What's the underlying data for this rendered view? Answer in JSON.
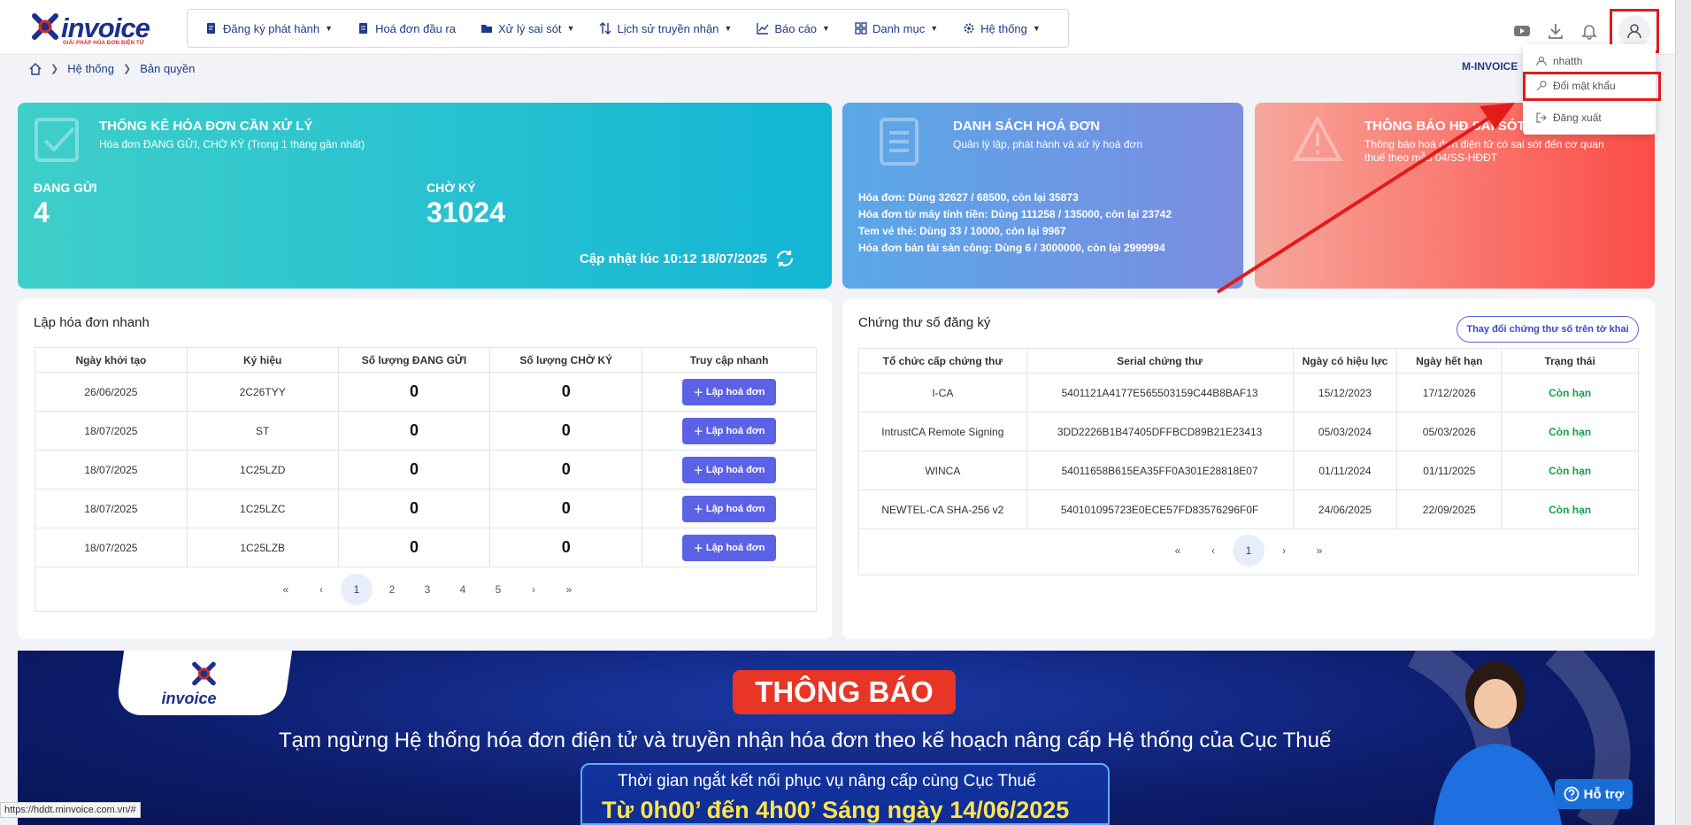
{
  "brand": {
    "name": "invoice",
    "tagline": "GIẢI PHÁP HÓA ĐƠN ĐIỆN TỬ"
  },
  "nav": [
    {
      "label": "Đăng ký phát hành",
      "icon": "file-edit-icon",
      "has_dropdown": true
    },
    {
      "label": "Hoá đơn đầu ra",
      "icon": "document-icon",
      "has_dropdown": false
    },
    {
      "label": "Xử lý sai sót",
      "icon": "folder-search-icon",
      "has_dropdown": true
    },
    {
      "label": "Lịch sử truyền nhận",
      "icon": "sort-arrows-icon",
      "has_dropdown": true
    },
    {
      "label": "Báo cáo",
      "icon": "line-chart-icon",
      "has_dropdown": true
    },
    {
      "label": "Danh mục",
      "icon": "grid-icon",
      "has_dropdown": true
    },
    {
      "label": "Hệ thống",
      "icon": "gear-icon",
      "has_dropdown": true
    }
  ],
  "breadcrumb": [
    "Hệ thống",
    "Bản quyền"
  ],
  "company_code": "M-INVOICE",
  "user_menu": {
    "username": "nhatth",
    "change_password": "Đổi mật khẩu",
    "logout": "Đăng xuất"
  },
  "stat_card": {
    "title": "THỐNG KÊ HÓA ĐƠN CẦN XỬ LÝ",
    "subtitle": "Hóa đơn ĐANG GỬI, CHỜ KÝ (Trong 1 tháng gần nhất)",
    "sending_label": "ĐANG GỬI",
    "sending_value": "4",
    "waiting_label": "CHỜ KÝ",
    "waiting_value": "31024",
    "updated": "Cập nhật lúc 10:12 18/07/2025"
  },
  "list_card": {
    "title": "DANH SÁCH HOÁ ĐƠN",
    "subtitle": "Quản lý lập, phát hành và xử lý hoá đơn",
    "lines": [
      "Hóa đơn: Dùng 32627 / 68500, còn lại 35873",
      "Hóa đơn từ máy tính tiền: Dùng 111258 / 135000, còn lại 23742",
      "Tem vé thẻ: Dùng 33 / 10000, còn lại 9967",
      "Hóa đơn bán tài sản công: Dùng 6 / 3000000, còn lại 2999994"
    ]
  },
  "warn_card": {
    "title": "THÔNG BÁO HĐ SAI SÓT",
    "subtitle_1": "Thông báo hoá đơn điện tử có sai sót đến cơ quan",
    "subtitle_2": "thuế theo mẫu 04/SS-HĐĐT"
  },
  "quick_panel": {
    "title": "Lập hóa đơn nhanh",
    "headers": [
      "Ngày khởi tạo",
      "Ký hiệu",
      "Số lượng ĐANG GỬI",
      "Số lượng CHỜ KÝ",
      "Truy cập nhanh"
    ],
    "button_label": "Lập hoá đơn",
    "rows": [
      {
        "date": "26/06/2025",
        "code": "2C26TYY",
        "sending": "0",
        "waiting": "0"
      },
      {
        "date": "18/07/2025",
        "code": "ST",
        "sending": "0",
        "waiting": "0"
      },
      {
        "date": "18/07/2025",
        "code": "1C25LZD",
        "sending": "0",
        "waiting": "0"
      },
      {
        "date": "18/07/2025",
        "code": "1C25LZC",
        "sending": "0",
        "waiting": "0"
      },
      {
        "date": "18/07/2025",
        "code": "1C25LZB",
        "sending": "0",
        "waiting": "0"
      }
    ],
    "pages": [
      "1",
      "2",
      "3",
      "4",
      "5"
    ],
    "current_page": "1"
  },
  "cert_panel": {
    "title": "Chứng thư số đăng ký",
    "button": "Thay đổi chứng thư số trên tờ khai",
    "headers": [
      "Tổ chức cấp chứng thư",
      "Serial chứng thư",
      "Ngày có hiệu lực",
      "Ngày hết hạn",
      "Trạng thái"
    ],
    "rows": [
      {
        "org": "I-CA",
        "serial": "5401121A4177E565503159C44B8BAF13",
        "from": "15/12/2023",
        "to": "17/12/2026",
        "status": "Còn hạn"
      },
      {
        "org": "IntrustCA Remote Signing",
        "serial": "3DD2226B1B47405DFFBCD89B21E23413",
        "from": "05/03/2024",
        "to": "05/03/2026",
        "status": "Còn hạn"
      },
      {
        "org": "WINCA",
        "serial": "54011658B615EA35FF0A301E28818E07",
        "from": "01/11/2024",
        "to": "01/11/2025",
        "status": "Còn hạn"
      },
      {
        "org": "NEWTEL-CA SHA-256 v2",
        "serial": "540101095723E0ECE57FD83576296F0F",
        "from": "24/06/2025",
        "to": "22/09/2025",
        "status": "Còn hạn"
      }
    ],
    "current_page": "1"
  },
  "banner": {
    "logo": "invoice",
    "badge": "THÔNG BÁO",
    "line": "Tạm ngừng Hệ thống hóa đơn điện tử và truyền nhận hóa đơn theo kế hoạch nâng cấp Hệ thống của Cục Thuế",
    "time_line_1": "Thời gian ngắt kết nối phục vụ nâng cấp cùng Cục Thuế",
    "time_line_2": "Từ 0h00’ đến 4h00’ Sáng ngày 14/06/2025"
  },
  "support_button": "Hỗ trợ",
  "status_url": "https://hddt.minvoice.com.vn/#",
  "colors": {
    "primary": "#1f3a8a",
    "button": "#5b62e5",
    "highlight": "#e21b1b",
    "ok": "#16a34a"
  }
}
